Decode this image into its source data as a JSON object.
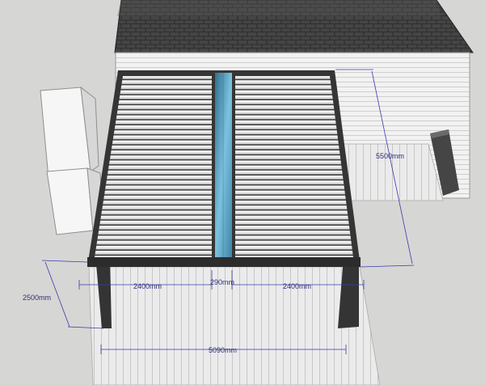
{
  "dimensions": {
    "depth_right": "5500mm",
    "bay_left": "2400mm",
    "gap_center": "290mm",
    "bay_right": "2400mm",
    "height_left": "2500mm",
    "overall_width": "5090mm"
  },
  "colors": {
    "background": "#d6d6d4",
    "roof_tiles": "#3f3f3f",
    "wall_siding": "#f1f1f1",
    "frame": "#353535",
    "louver": "#dcdcdc",
    "glass": "#6fb1d3",
    "deck": "#e9e9e9",
    "dimension_line": "#3a3ab0"
  }
}
